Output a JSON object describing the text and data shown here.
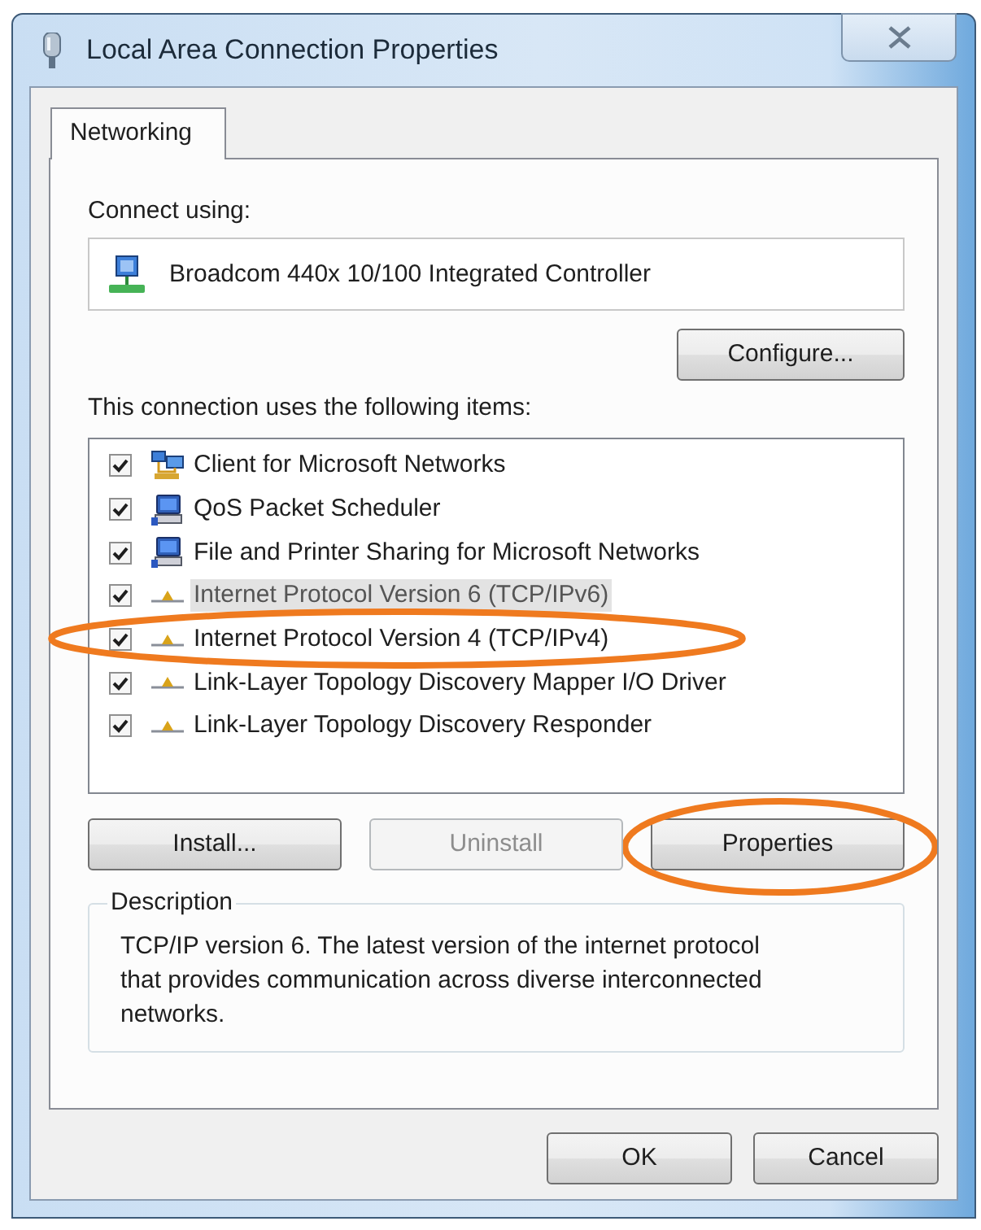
{
  "window": {
    "title": "Local Area Connection Properties"
  },
  "tabs": [
    {
      "label": "Networking",
      "selected": true
    }
  ],
  "connect_using": {
    "label": "Connect using:",
    "adapter": "Broadcom 440x 10/100 Integrated Controller",
    "button": "Configure..."
  },
  "components": {
    "label": "This connection uses the following items:",
    "items": [
      {
        "kind": "client",
        "label": "Client for Microsoft Networks",
        "checked": true,
        "selected": false,
        "circled": false
      },
      {
        "kind": "service",
        "label": "QoS Packet Scheduler",
        "checked": true,
        "selected": false,
        "circled": false
      },
      {
        "kind": "service",
        "label": "File and Printer Sharing for Microsoft Networks",
        "checked": true,
        "selected": false,
        "circled": false
      },
      {
        "kind": "protocol",
        "label": "Internet Protocol Version 6 (TCP/IPv6)",
        "checked": true,
        "selected": true,
        "circled": false
      },
      {
        "kind": "protocol",
        "label": "Internet Protocol Version 4 (TCP/IPv4)",
        "checked": true,
        "selected": false,
        "circled": true
      },
      {
        "kind": "protocol",
        "label": "Link-Layer Topology Discovery Mapper I/O Driver",
        "checked": true,
        "selected": false,
        "circled": false
      },
      {
        "kind": "protocol",
        "label": "Link-Layer Topology Discovery Responder",
        "checked": true,
        "selected": false,
        "circled": false
      }
    ]
  },
  "item_buttons": [
    {
      "label": "Install...",
      "disabled": false,
      "circled": false
    },
    {
      "label": "Uninstall",
      "disabled": true,
      "circled": false
    },
    {
      "label": "Properties",
      "disabled": false,
      "circled": true
    }
  ],
  "description": {
    "title": "Description",
    "text": "TCP/IP version 6. The latest version of the internet protocol that provides communication across diverse interconnected networks."
  },
  "dialog_buttons": [
    "OK",
    "Cancel"
  ]
}
